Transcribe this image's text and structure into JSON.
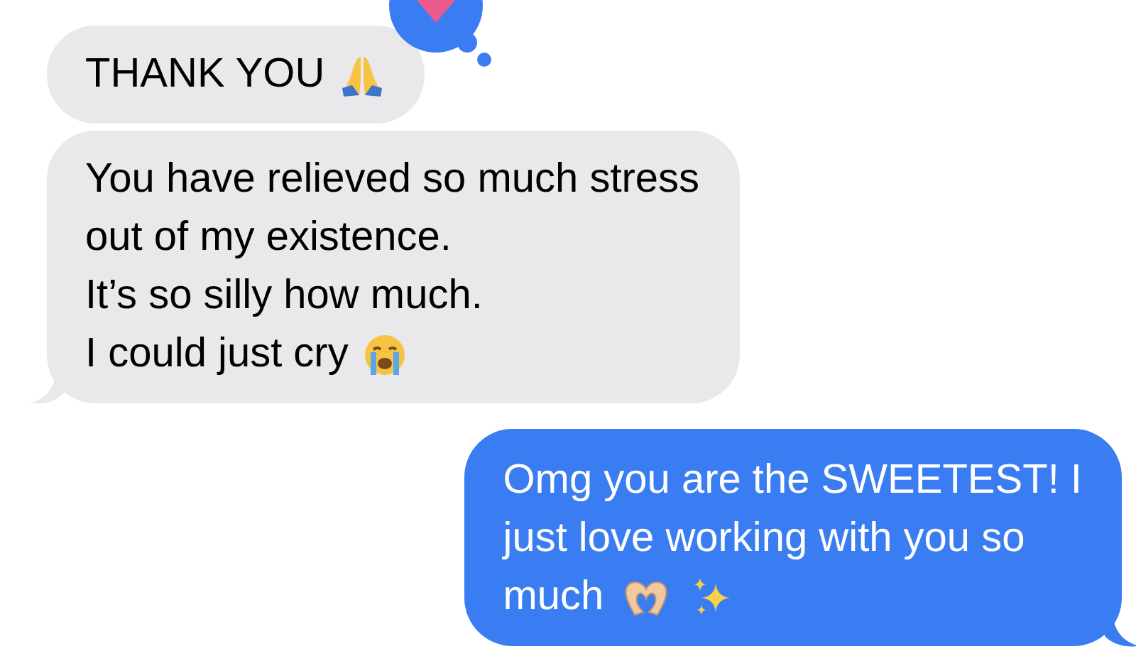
{
  "messages": [
    {
      "kind": "received",
      "lines": [
        "THANK YOU"
      ],
      "reacted": true
    },
    {
      "kind": "received",
      "lines": [
        "You have relieved so much stress",
        "out of my existence.",
        "It’s so silly how much.",
        "I could just cry"
      ],
      "reacted": false
    },
    {
      "kind": "sent",
      "lines": [
        "Omg you are the SWEETEST! I",
        "just love working with you so",
        "much"
      ],
      "reacted": false
    }
  ]
}
